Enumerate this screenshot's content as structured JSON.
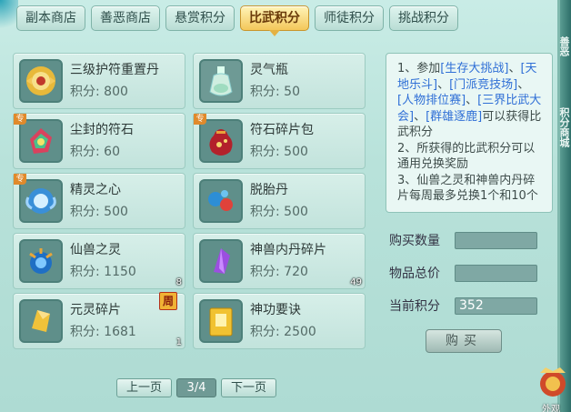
{
  "tabs": [
    {
      "label": "副本商店",
      "active": false
    },
    {
      "label": "善恶商店",
      "active": false
    },
    {
      "label": "悬赏积分",
      "active": false
    },
    {
      "label": "比武积分",
      "active": true
    },
    {
      "label": "师徒积分",
      "active": false
    },
    {
      "label": "挑战积分",
      "active": false
    }
  ],
  "items": [
    {
      "name": "三级护符重置丹",
      "points": "积分: 800",
      "icon": "golden-charm-pill-icon"
    },
    {
      "name": "灵气瓶",
      "points": "积分: 50",
      "icon": "spirit-bottle-icon"
    },
    {
      "name": "尘封的符石",
      "points": "积分: 60",
      "icon": "sealed-rune-stone-icon",
      "badge": "专"
    },
    {
      "name": "符石碎片包",
      "points": "积分: 500",
      "icon": "rune-fragment-bag-icon",
      "badge": "专"
    },
    {
      "name": "精灵之心",
      "points": "积分: 500",
      "icon": "elf-heart-icon",
      "badge": "专"
    },
    {
      "name": "脱胎丹",
      "points": "积分: 500",
      "icon": "rebirth-pill-icon"
    },
    {
      "name": "仙兽之灵",
      "points": "积分: 1150",
      "icon": "beast-spirit-icon",
      "qty": "8"
    },
    {
      "name": "神兽内丹碎片",
      "points": "积分: 720",
      "icon": "crystal-shard-icon",
      "qty": "49"
    },
    {
      "name": "元灵碎片",
      "points": "积分: 1681",
      "icon": "yuanling-shard-icon",
      "qty": "1",
      "tag": "周"
    },
    {
      "name": "神功要诀",
      "points": "积分: 2500",
      "icon": "skill-book-icon"
    }
  ],
  "info": {
    "lines": [
      {
        "text": "1、参加",
        "hl": false
      },
      {
        "text": "[生存大挑战]",
        "hl": true
      },
      {
        "text": "、",
        "hl": false
      },
      {
        "text": "[天地乐斗]",
        "hl": true
      },
      {
        "text": "、",
        "hl": false
      },
      {
        "text": "[门派竞技场]",
        "hl": true
      },
      {
        "text": "、",
        "hl": false
      },
      {
        "text": "[人物排位赛]",
        "hl": true
      },
      {
        "text": "、",
        "hl": false
      },
      {
        "text": "[三界比武大会]",
        "hl": true
      },
      {
        "text": "、",
        "hl": false
      },
      {
        "text": "[群雄逐鹿]",
        "hl": true
      },
      {
        "text": "可以获得比武积分",
        "hl": false
      },
      {
        "text": "\n2、所获得的比武积分可以通用兑换奖励",
        "hl": false
      },
      {
        "text": "\n3、仙兽之灵和神兽内丹碎片每周最多兑换1个和10个",
        "hl": false
      }
    ]
  },
  "form": {
    "qty_label": "购买数量",
    "qty_value": "",
    "total_label": "物品总价",
    "total_value": "",
    "current_label": "当前积分",
    "current_value": "352"
  },
  "buy_label": "购买",
  "pager": {
    "prev": "上一页",
    "page": "3/4",
    "next": "下一页"
  },
  "side_tags": [
    "善恶",
    "积分商城"
  ],
  "corner_text": "外观"
}
